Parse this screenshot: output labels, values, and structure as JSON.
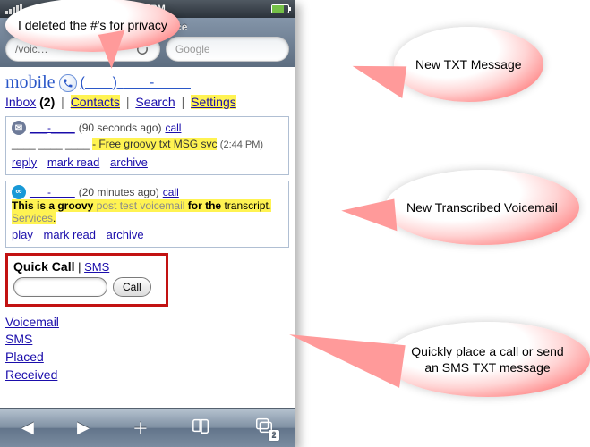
{
  "statusbar": {
    "time": "2:45 PM"
  },
  "chromebar": {
    "title_prefix": "Google Voice",
    "address_fragment": "/voic…",
    "search_placeholder": "Google"
  },
  "header": {
    "mobile_label": "mobile",
    "redacted_prefix": "(___)",
    "redacted_rest": "___-____"
  },
  "nav": {
    "inbox": "Inbox",
    "inbox_count": "(2)",
    "contacts": "Contacts",
    "search": "Search",
    "settings": "Settings"
  },
  "messages": [
    {
      "from_redacted": "___-____",
      "age": "(90 seconds ago)",
      "call_label": "call",
      "body_highlight": "- Free groovy txt MSG svc",
      "time": "(2:44 PM)",
      "actions": {
        "a1": "reply",
        "a2": "mark read",
        "a3": "archive"
      }
    },
    {
      "from_redacted": "___-____",
      "age": "(20 minutes ago)",
      "call_label": "call",
      "trans_p1": "This is a groovy",
      "trans_gray": "post test voicemail",
      "trans_p2": "for the",
      "trans_p3": "transcript",
      "trans_tail": ".",
      "trans_gray2_pre": "Services",
      "trans_gray2_post": ".",
      "actions": {
        "a1": "play",
        "a2": "mark read",
        "a3": "archive"
      }
    }
  ],
  "quickcall": {
    "title": "Quick Call",
    "sms_link": "SMS",
    "button": "Call"
  },
  "bottomlinks": {
    "voicemail": "Voicemail",
    "sms": "SMS",
    "placed": "Placed",
    "received": "Received"
  },
  "bottombar": {
    "pages": "2"
  },
  "callouts": {
    "privacy": "I deleted the #'s for privacy",
    "txt": "New TXT Message",
    "vm": "New Transcribed Voicemail",
    "qc": "Quickly place a call or send an SMS TXT message"
  }
}
